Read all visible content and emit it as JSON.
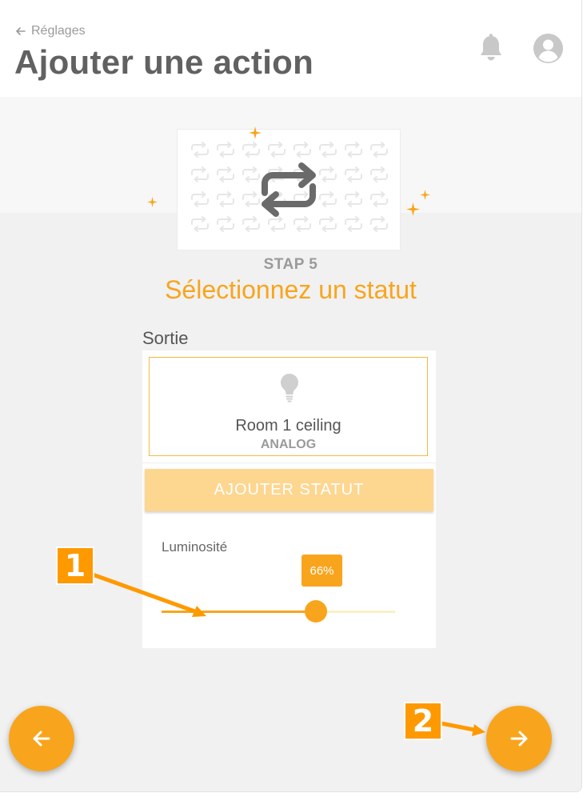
{
  "header": {
    "back_label": "Réglages",
    "title": "Ajouter une action",
    "icons": [
      "arrow-left-icon",
      "bell-icon",
      "user-avatar-icon"
    ]
  },
  "hero": {
    "icon": "repeat-arrows-icon"
  },
  "step": {
    "label": "STAP 5",
    "title": "Sélectionnez un statut"
  },
  "section_label": "Sortie",
  "output": {
    "icon": "lightbulb-icon",
    "name": "Room 1 ceiling",
    "type": "ANALOG"
  },
  "add_status_label": "AJOUTER STATUT",
  "slider": {
    "label": "Luminosité",
    "value_label": "66%",
    "value": 0.66
  },
  "nav": {
    "prev_icon": "arrow-left-icon",
    "next_icon": "arrow-right-icon"
  },
  "callouts": {
    "one": "1",
    "two": "2"
  },
  "colors": {
    "accent": "#f8a51d",
    "accent_light": "#fdd690",
    "callout": "#ff9900",
    "text_gray": "#616161"
  }
}
